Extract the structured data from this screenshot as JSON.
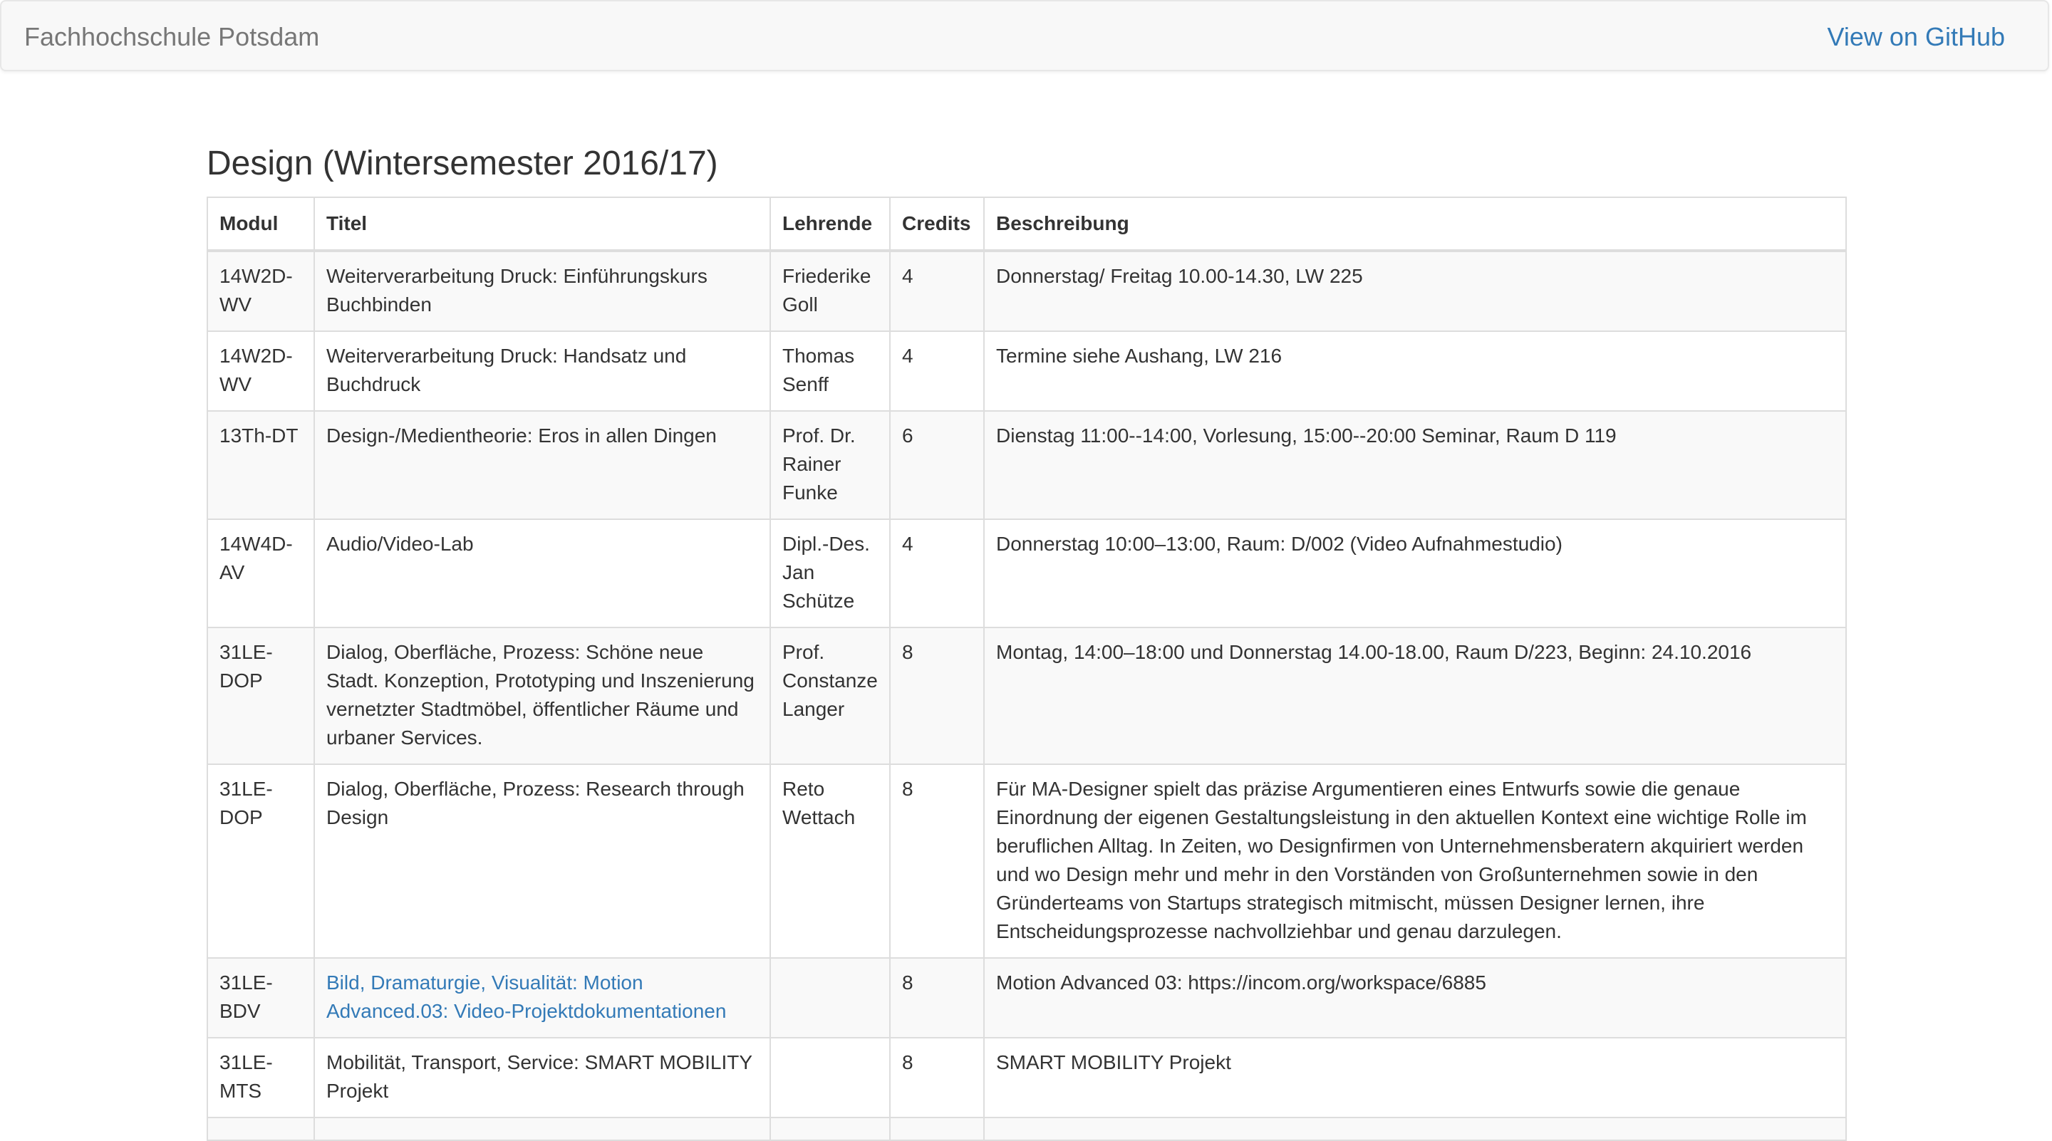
{
  "navbar": {
    "brand": "Fachhochschule Potsdam",
    "github_link": "View on GitHub"
  },
  "page": {
    "title": "Design (Wintersemester 2016/17)"
  },
  "table": {
    "headers": {
      "modul": "Modul",
      "titel": "Titel",
      "lehrende": "Lehrende",
      "credits": "Credits",
      "beschreibung": "Beschreibung"
    },
    "rows": [
      {
        "modul": "14W2D-WV",
        "titel": "Weiterverarbeitung Druck: Einführungskurs Buchbinden",
        "lehrende": "Friederike Goll",
        "credits": "4",
        "beschreibung": "Donnerstag/ Freitag 10.00-14.30, LW 225"
      },
      {
        "modul": "14W2D-WV",
        "titel": "Weiterverarbeitung Druck: Handsatz und Buchdruck",
        "lehrende": "Thomas Senff",
        "credits": "4",
        "beschreibung": "Termine siehe Aushang, LW 216"
      },
      {
        "modul": "13Th-DT",
        "titel": "Design-/Medientheorie: Eros in allen Dingen",
        "lehrende": "Prof. Dr. Rainer Funke",
        "credits": "6",
        "beschreibung": "Dienstag 11:00--14:00, Vorlesung, 15:00--20:00 Seminar, Raum D 119"
      },
      {
        "modul": "14W4D-AV",
        "titel": "Audio/Video-Lab",
        "lehrende": "Dipl.-Des. Jan Schütze",
        "credits": "4",
        "beschreibung": "Donnerstag 10:00–13:00, Raum: D/002 (Video Aufnahmestudio)"
      },
      {
        "modul": "31LE-DOP",
        "titel": "Dialog, Oberfläche, Prozess: Schöne neue Stadt. Konzeption, Prototyping und Inszenierung vernetzter Stadtmöbel, öffentlicher Räume und urbaner Services.",
        "lehrende": "Prof. Constanze Langer",
        "credits": "8",
        "beschreibung": "Montag, 14:00–18:00 und Donnerstag 14.00-18.00, Raum D/223, Beginn: 24.10.2016"
      },
      {
        "modul": "31LE-DOP",
        "titel": "Dialog, Oberfläche, Prozess: Research through Design",
        "lehrende": "Reto Wettach",
        "credits": "8",
        "beschreibung": "Für MA-Designer spielt das präzise Argumentieren eines Entwurfs sowie die genaue Einordnung der eigenen Gestaltungsleistung in den aktuellen Kontext eine wichtige Rolle im beruflichen Alltag. In Zeiten, wo Designfirmen von Unternehmensberatern akquiriert werden und wo Design mehr und mehr in den Vorständen von Großunternehmen sowie in den Gründerteams von Startups strategisch mitmischt, müssen Designer lernen, ihre Entscheidungsprozesse nachvollziehbar und genau darzulegen."
      },
      {
        "modul": "31LE-BDV",
        "titel": "Bild, Dramaturgie, Visualität: Motion Advanced.03: Video-Projektdokumentationen",
        "titel_is_link": true,
        "lehrende": "",
        "credits": "8",
        "beschreibung": "Motion Advanced 03: https://incom.org/workspace/6885"
      },
      {
        "modul": "31LE-MTS",
        "titel": "Mobilität, Transport, Service: SMART MOBILITY Projekt",
        "lehrende": "",
        "credits": "8",
        "beschreibung": "SMART MOBILITY Projekt"
      },
      {
        "modul": "",
        "titel": "",
        "lehrende": "",
        "credits": "",
        "beschreibung": ""
      }
    ]
  },
  "colors": {
    "link": "#337ab7",
    "brand": "#777777",
    "navbar_bg": "#f8f8f8",
    "stripe": "#f9f9f9",
    "border": "#dddddd"
  }
}
